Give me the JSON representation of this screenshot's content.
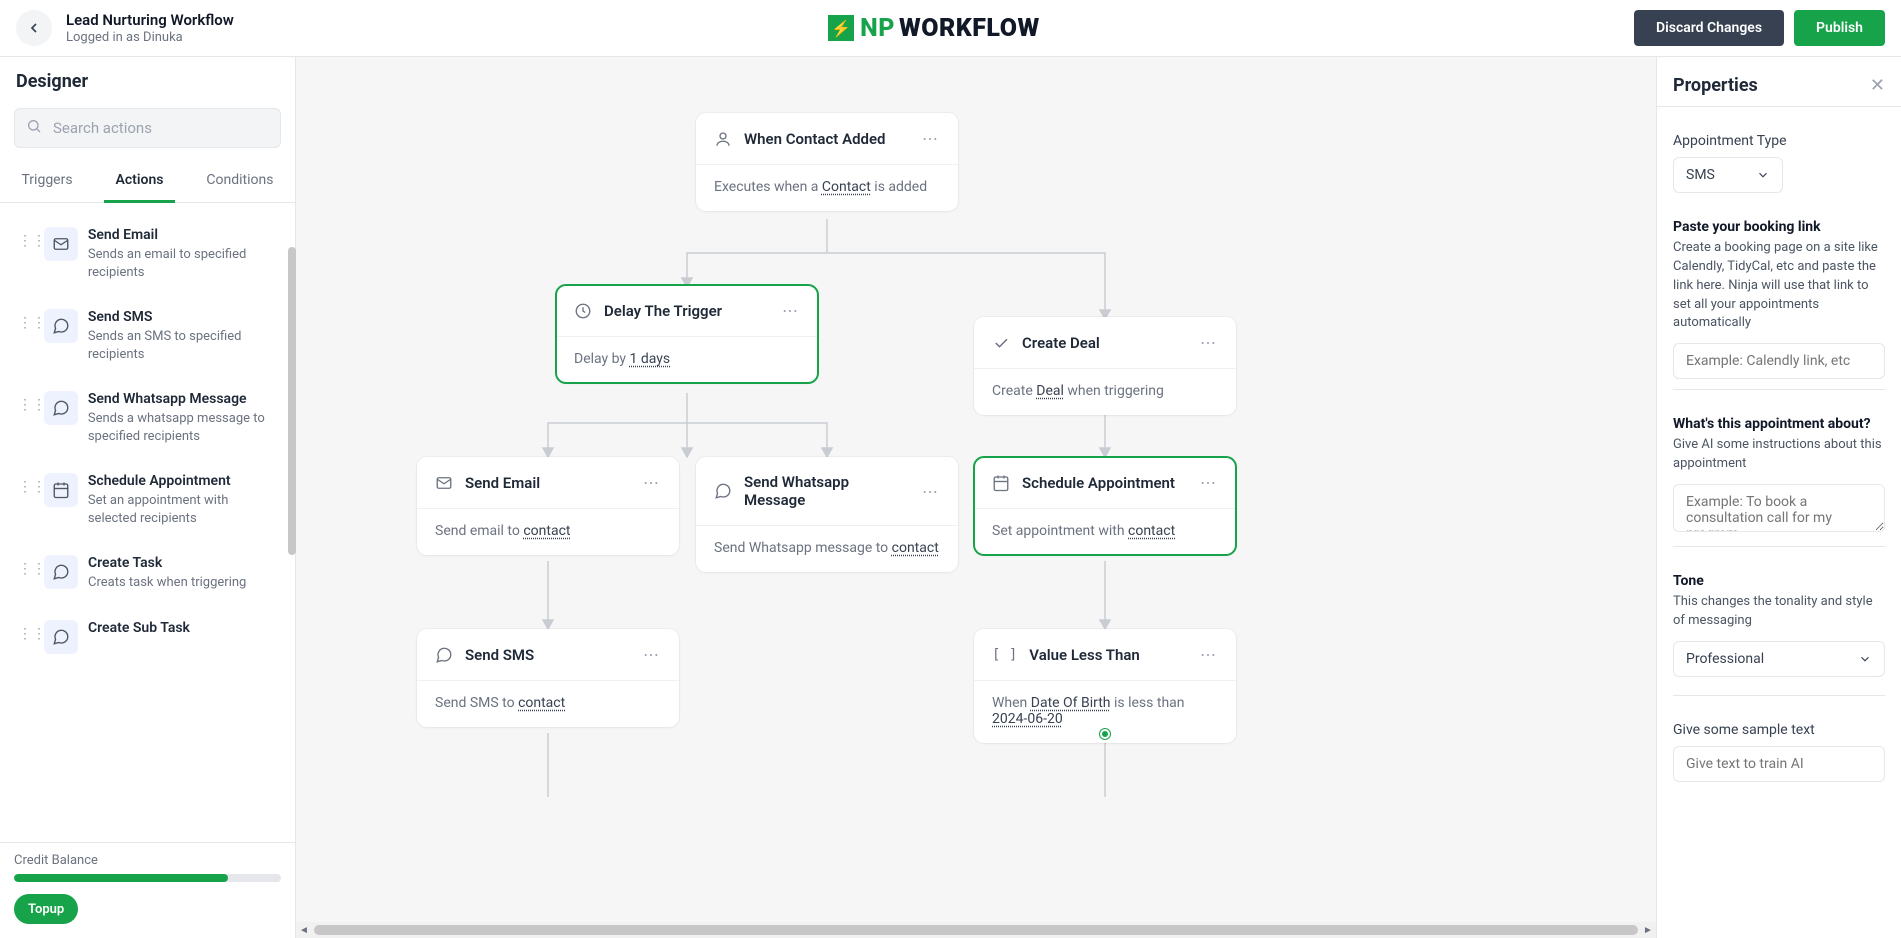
{
  "header": {
    "workflow_title": "Lead Nurturing Workflow",
    "login_line": "Logged in as Dinuka",
    "brand_np": "NP",
    "brand_wf": "WORKFLOW",
    "discard": "Discard Changes",
    "publish": "Publish"
  },
  "sidebar": {
    "title": "Designer",
    "search_placeholder": "Search actions",
    "tabs": {
      "triggers": "Triggers",
      "actions": "Actions",
      "conditions": "Conditions"
    },
    "actions": [
      {
        "title": "Send Email",
        "desc": "Sends an email to specified recipients"
      },
      {
        "title": "Send SMS",
        "desc": "Sends an SMS to specified recipients"
      },
      {
        "title": "Send Whatsapp Message",
        "desc": "Sends a whatsapp message to specified recipients"
      },
      {
        "title": "Schedule Appointment",
        "desc": "Set an appointment with selected recipients"
      },
      {
        "title": "Create Task",
        "desc": "Creats task when triggering"
      },
      {
        "title": "Create Sub Task",
        "desc": ""
      }
    ],
    "credit_label": "Credit Balance",
    "topup": "Topup"
  },
  "canvas": {
    "n1": {
      "title": "When Contact Added",
      "body_pre": "Executes when a ",
      "body_u": "Contact",
      "body_post": " is added"
    },
    "n2": {
      "title": "Delay The Trigger",
      "body_pre": "Delay by ",
      "body_u": "1 days",
      "body_post": ""
    },
    "n3": {
      "title": "Create Deal",
      "body_pre": "Create ",
      "body_u": "Deal",
      "body_post": " when triggering"
    },
    "n4": {
      "title": "Send Email",
      "body_pre": "Send email to ",
      "body_u": "contact",
      "body_post": ""
    },
    "n5": {
      "title": "Send Whatsapp Message",
      "body_pre": "Send Whatsapp message to ",
      "body_u": "contact",
      "body_post": ""
    },
    "n6": {
      "title": "Schedule Appointment",
      "body_pre": "Set appointment with ",
      "body_u": "contact",
      "body_post": ""
    },
    "n7": {
      "title": "Send SMS",
      "body_pre": "Send SMS to ",
      "body_u": "contact",
      "body_post": ""
    },
    "n8": {
      "title": "Value Less Than",
      "body_pre": "When ",
      "body_u": "Date Of Birth",
      "body_mid": " is less than ",
      "body_u2": "2024-06-20",
      "body_post": ""
    }
  },
  "props": {
    "title": "Properties",
    "appt_type_label": "Appointment Type",
    "appt_type_value": "SMS",
    "booking_strong": "Paste your booking link",
    "booking_help": "Create a booking page on a site like Calendly, TidyCal, etc and paste the link here. Ninja will use that link to set all your appointments automatically",
    "booking_ph": "Example: Calendly link, etc",
    "about_strong": "What's this appointment about?",
    "about_help": "Give AI some instructions about this appointment",
    "about_ph": "Example: To book a consultation call for my program",
    "tone_strong": "Tone",
    "tone_help": "This changes the tonality and style of messaging",
    "tone_value": "Professional",
    "sample_label": "Give some sample text",
    "sample_ph": "Give text to train AI"
  }
}
